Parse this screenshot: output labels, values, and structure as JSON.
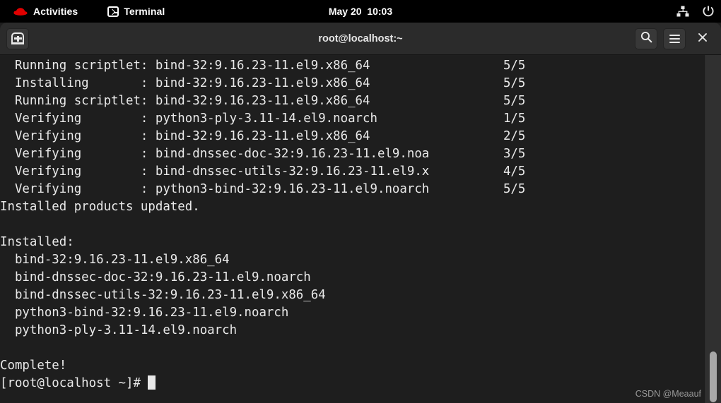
{
  "topbar": {
    "logo_icon": "red-hat-logo-icon",
    "activities_label": "Activities",
    "app_icon": "terminal-icon",
    "app_label": "Terminal",
    "clock": "May 20  10:03",
    "network_icon": "network-wired-icon",
    "power_icon": "power-icon",
    "background_color": "#000000"
  },
  "window": {
    "title": "root@localhost:~",
    "header": {
      "new_tab_icon": "new-tab-icon",
      "search_icon": "search-icon",
      "menu_icon": "hamburger-menu-icon",
      "close_icon": "close-icon",
      "close_label": "×",
      "background_color": "#2b2b2b"
    },
    "terminal": {
      "background_color": "#1e1e1e",
      "foreground_color": "#e9e9e9",
      "lines": [
        "  Running scriptlet: bind-32:9.16.23-11.el9.x86_64                  5/5 ",
        "  Installing       : bind-32:9.16.23-11.el9.x86_64                  5/5 ",
        "  Running scriptlet: bind-32:9.16.23-11.el9.x86_64                  5/5 ",
        "  Verifying        : python3-ply-3.11-14.el9.noarch                 1/5 ",
        "  Verifying        : bind-32:9.16.23-11.el9.x86_64                  2/5 ",
        "  Verifying        : bind-dnssec-doc-32:9.16.23-11.el9.noa          3/5 ",
        "  Verifying        : bind-dnssec-utils-32:9.16.23-11.el9.x          4/5 ",
        "  Verifying        : python3-bind-32:9.16.23-11.el9.noarch          5/5 ",
        "Installed products updated.",
        "",
        "Installed:",
        "  bind-32:9.16.23-11.el9.x86_64",
        "  bind-dnssec-doc-32:9.16.23-11.el9.noarch",
        "  bind-dnssec-utils-32:9.16.23-11.el9.x86_64",
        "  python3-bind-32:9.16.23-11.el9.noarch",
        "  python3-ply-3.11-14.el9.noarch",
        "",
        "Complete!"
      ],
      "prompt": "[root@localhost ~]# ",
      "cursor": "block-cursor"
    },
    "scrollbar": {
      "name": "vertical-scrollbar",
      "thumb_color": "#a8a8a8",
      "track_color": "#303030"
    },
    "watermark": "CSDN @Meaauf"
  }
}
